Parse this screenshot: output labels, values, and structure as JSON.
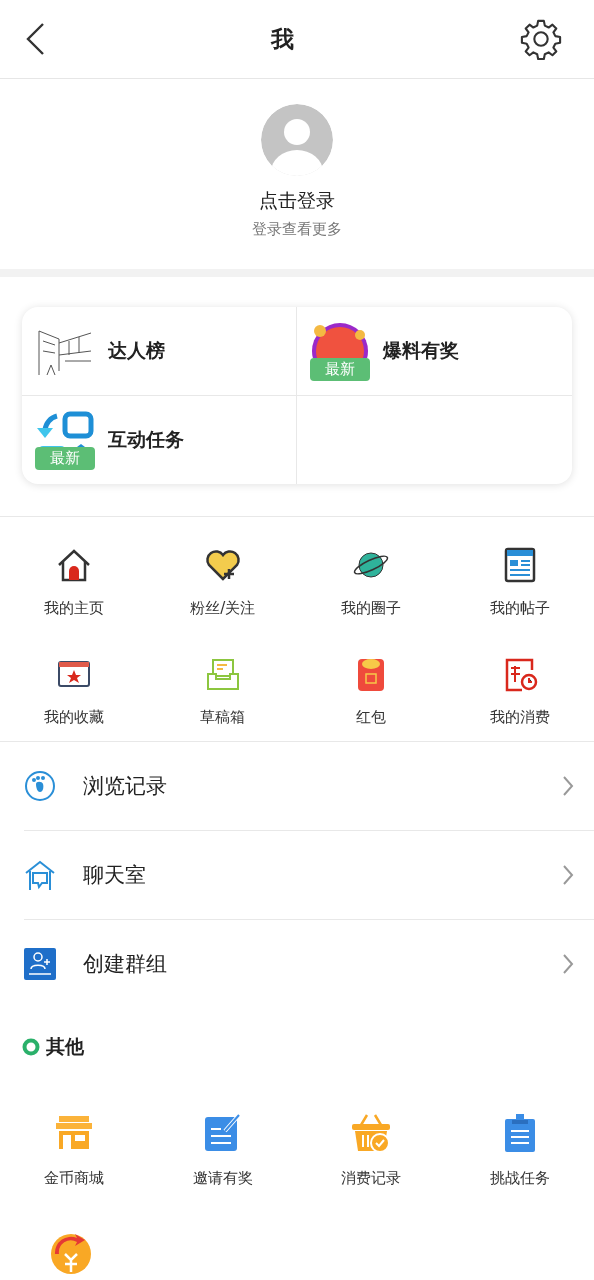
{
  "header": {
    "title": "我"
  },
  "profile": {
    "login": "点击登录",
    "hint": "登录查看更多"
  },
  "feature_cards": [
    {
      "label": "达人榜"
    },
    {
      "label": "爆料有奖",
      "badge": "最新"
    },
    {
      "label": "互动任务",
      "badge": "最新"
    }
  ],
  "shortcuts": [
    {
      "label": "我的主页"
    },
    {
      "label": "粉丝/关注"
    },
    {
      "label": "我的圈子"
    },
    {
      "label": "我的帖子"
    },
    {
      "label": "我的收藏"
    },
    {
      "label": "草稿箱"
    },
    {
      "label": "红包"
    },
    {
      "label": "我的消费"
    }
  ],
  "menu": [
    {
      "label": "浏览记录"
    },
    {
      "label": "聊天室"
    },
    {
      "label": "创建群组"
    }
  ],
  "other": {
    "title": "其他",
    "items": [
      {
        "label": "金币商城"
      },
      {
        "label": "邀请有奖"
      },
      {
        "label": "消费记录"
      },
      {
        "label": "挑战任务"
      }
    ]
  }
}
